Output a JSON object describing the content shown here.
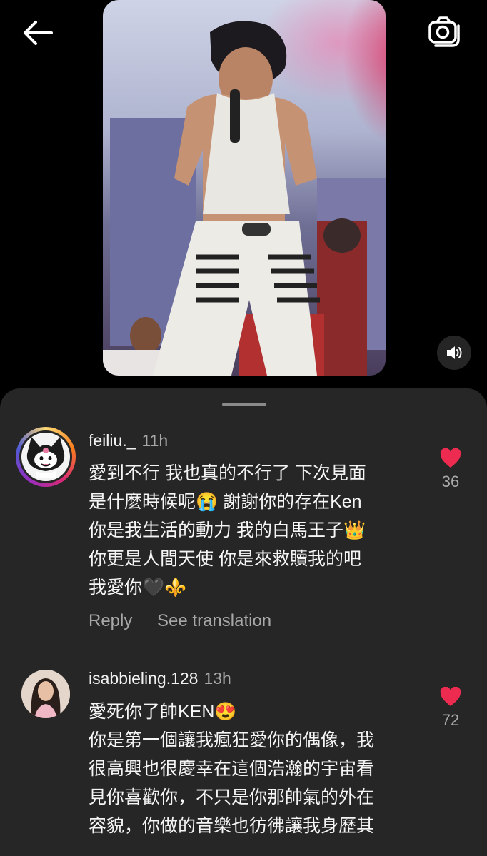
{
  "header": {
    "back_icon": "arrow-left-icon",
    "camera_icon": "camera-switch-icon"
  },
  "video": {
    "mute_icon": "speaker-icon",
    "liked_icon": "heart-filled-icon",
    "accent_color": "#ed2b50"
  },
  "comments": [
    {
      "username": "feiliu._",
      "time": "11h",
      "text": "愛到不行 我也真的不行了 下次見面\n是什麼時候呢😭 謝謝你的存在Ken\n你是我生活的動力 我的白馬王子👑\n你更是人間天使 你是來救贖我的吧\n我愛你🖤⚜️",
      "reply_label": "Reply",
      "translate_label": "See translation",
      "likes": "36"
    },
    {
      "username": "isabbieling.128",
      "time": "13h",
      "text": "愛死你了帥KEN😍\n你是第一個讓我瘋狂愛你的偶像，我\n很高興也很慶幸在這個浩瀚的宇宙看\n見你喜歡你，不只是你那帥氣的外在\n容貌，你做的音樂也彷彿讓我身歷其",
      "likes": "72"
    }
  ]
}
